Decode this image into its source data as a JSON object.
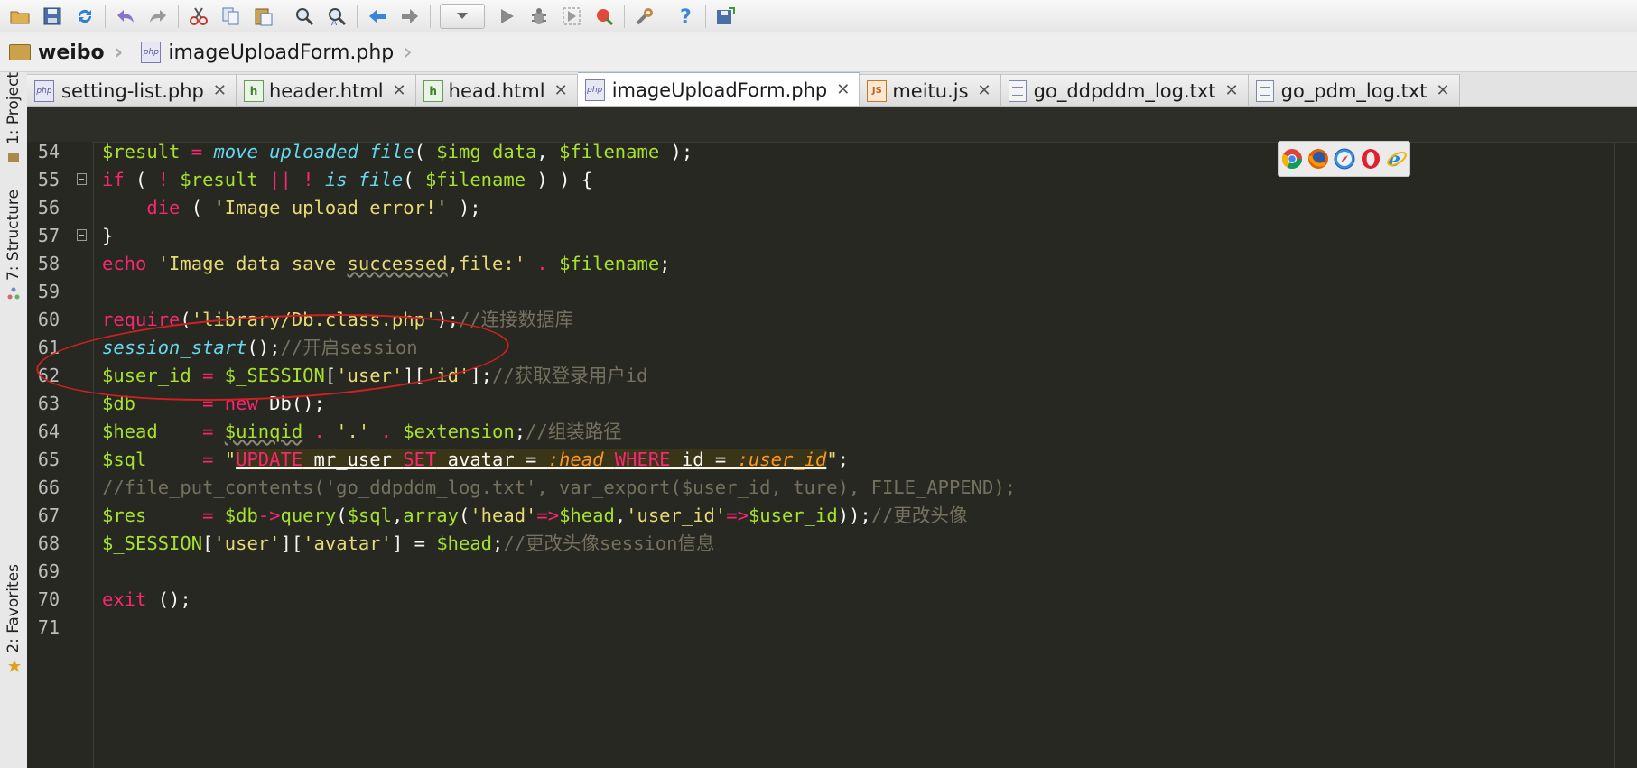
{
  "toolbar": {
    "icons": [
      "open-folder-icon",
      "save-icon",
      "sync-icon",
      "undo-icon",
      "redo-icon",
      "cut-icon",
      "copy-icon",
      "paste-icon",
      "find-icon",
      "replace-icon",
      "back-icon",
      "forward-icon",
      "run-config-dropdown",
      "run-icon",
      "debug-icon",
      "run-with-coverage-icon",
      "stop-icon",
      "settings-icon",
      "help-icon",
      "vcs-icon"
    ]
  },
  "breadcrumb": {
    "project": "weibo",
    "file": "imageUploadForm.php"
  },
  "sidebar": {
    "project_label": "1: Project",
    "structure_label": "7: Structure",
    "favorites_label": "2: Favorites"
  },
  "tabs": [
    {
      "label": "setting-list.php",
      "type": "php"
    },
    {
      "label": "header.html",
      "type": "html"
    },
    {
      "label": "head.html",
      "type": "html"
    },
    {
      "label": "imageUploadForm.php",
      "type": "php",
      "active": true
    },
    {
      "label": "meitu.js",
      "type": "js"
    },
    {
      "label": "go_ddpddm_log.txt",
      "type": "txt"
    },
    {
      "label": "go_pdm_log.txt",
      "type": "txt"
    }
  ],
  "colors": {
    "editor_bg": "#272822",
    "keyword": "#f92672",
    "variable": "#a6e22e",
    "string": "#e6db74",
    "function": "#66d9ef",
    "comment": "#75715e",
    "annotation": "#d21f1f"
  },
  "code": {
    "line_numbers": [
      "54",
      "55",
      "56",
      "57",
      "58",
      "59",
      "60",
      "61",
      "62",
      "63",
      "64",
      "65",
      "66",
      "67",
      "68",
      "69",
      "70",
      "71"
    ],
    "l54": {
      "var": "$result",
      "eq": " = ",
      "fn": "move_uploaded_file",
      "a": "( ",
      "v1": "$img_data",
      ",": ", ",
      "v2": "$filename",
      "b": " );"
    },
    "l55": {
      "kw": "if",
      "a": " ( ",
      "not1": "!",
      "sp": " ",
      "v1": "$result",
      "or": " || ",
      "not2": "!",
      "sp2": " ",
      "fn": "is_file",
      "b": "( ",
      "v2": "$filename",
      "c": " ) ) {"
    },
    "l56": {
      "indent": "    ",
      "kw": "die",
      "a": " ( ",
      "str": "'Image upload error!'",
      "b": " );"
    },
    "l57": {
      "t": "}"
    },
    "l58": {
      "kw": "echo",
      "sp": " ",
      "s1": "'Image data save ",
      "s2": "successed",
      "s3": ",file:'",
      "dot": " . ",
      "v": "$filename",
      "end": ";"
    },
    "l60": {
      "kw": "require",
      "a": "(",
      "str": "'library/Db.class.php'",
      "b": ");",
      "cm": "//连接数据库"
    },
    "l61": {
      "fn": "session_start",
      "a": "();",
      "cm": "//开启session"
    },
    "l62": {
      "v": "$user_id",
      "eq": " = ",
      "s": "$_SESSION",
      "a": "[",
      "k1": "'user'",
      "b": "][",
      "k2": "'id'",
      "c": "];",
      "cm": "//获取登录用户id"
    },
    "l63": {
      "v": "$db",
      "eq": "      = ",
      "kw": "new",
      "sp": " ",
      "cls": "Db",
      "a": "();"
    },
    "l64": {
      "v": "$head",
      "eq": "    = ",
      "v2": "$uinqid",
      "d1": " . ",
      "s": "'.'",
      "d2": " . ",
      "v3": "$extension",
      "a": ";",
      "cm": "//组装路径"
    },
    "l65": {
      "v": "$sql",
      "eq": "     = ",
      "q1": "\"",
      "kw1": "UPDATE",
      "t1": " mr_user ",
      "kw2": "SET",
      "t2": " avatar = ",
      "p1": ":head",
      "sp": " ",
      "kw3": "WHERE",
      "t3": " id = ",
      "p2": ":user_id",
      "q2": "\"",
      "end": ";"
    },
    "l66": {
      "cm": "//file_put_contents('go_ddpddm_log.txt', var_export($user_id, ture), FILE_APPEND);"
    },
    "l67": {
      "v": "$res",
      "eq": "     = ",
      "v2": "$db",
      "arrow": "->",
      "fn": "query",
      "a": "(",
      "v3": "$sql",
      "b": ",",
      "fn2": "array",
      "c": "(",
      "k1": "'head'",
      "ar1": "=>",
      "v4": "$head",
      "cm2": ",",
      "k2": "'user_id'",
      "ar2": "=>",
      "v5": "$user_id",
      "d": "));",
      "cm": "//更改头像"
    },
    "l68": {
      "s": "$_SESSION",
      "a": "[",
      "k1": "'user'",
      "b": "][",
      "k2": "'avatar'",
      "c": "] = ",
      "v": "$head",
      "d": ";",
      "cm": "//更改头像session信息"
    },
    "l70": {
      "kw": "exit",
      "a": " ();"
    }
  }
}
